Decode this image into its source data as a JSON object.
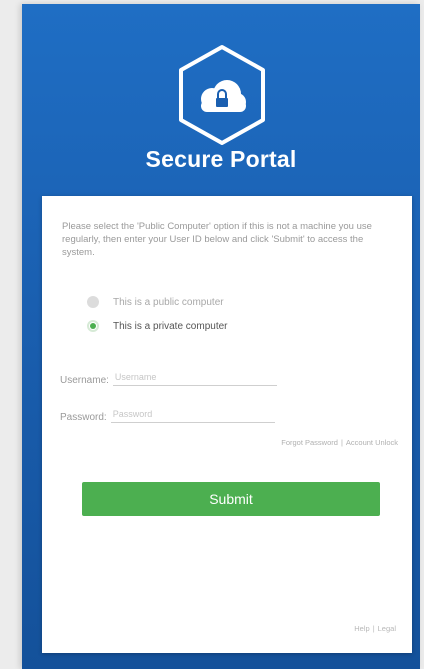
{
  "portal": {
    "title": "Secure Portal",
    "logo_icon": "cloud-lock-icon",
    "background_color": "#1a5fb0",
    "accent_color": "#4caf50"
  },
  "login": {
    "instructions": "Please select the 'Public Computer' option if this is not a machine you use regularly, then enter your User ID below and click 'Submit' to access the system.",
    "computer_options": [
      {
        "label": "This is a public computer",
        "selected": false
      },
      {
        "label": "This is a private computer",
        "selected": true
      }
    ],
    "username_label": "Username:",
    "username_placeholder": "Username",
    "password_label": "Password:",
    "password_placeholder": "Password",
    "forgot_password": "Forgot Password",
    "account_unlock": "Account Unlock",
    "submit_label": "Submit"
  },
  "footer": {
    "help": "Help",
    "legal": "Legal"
  }
}
